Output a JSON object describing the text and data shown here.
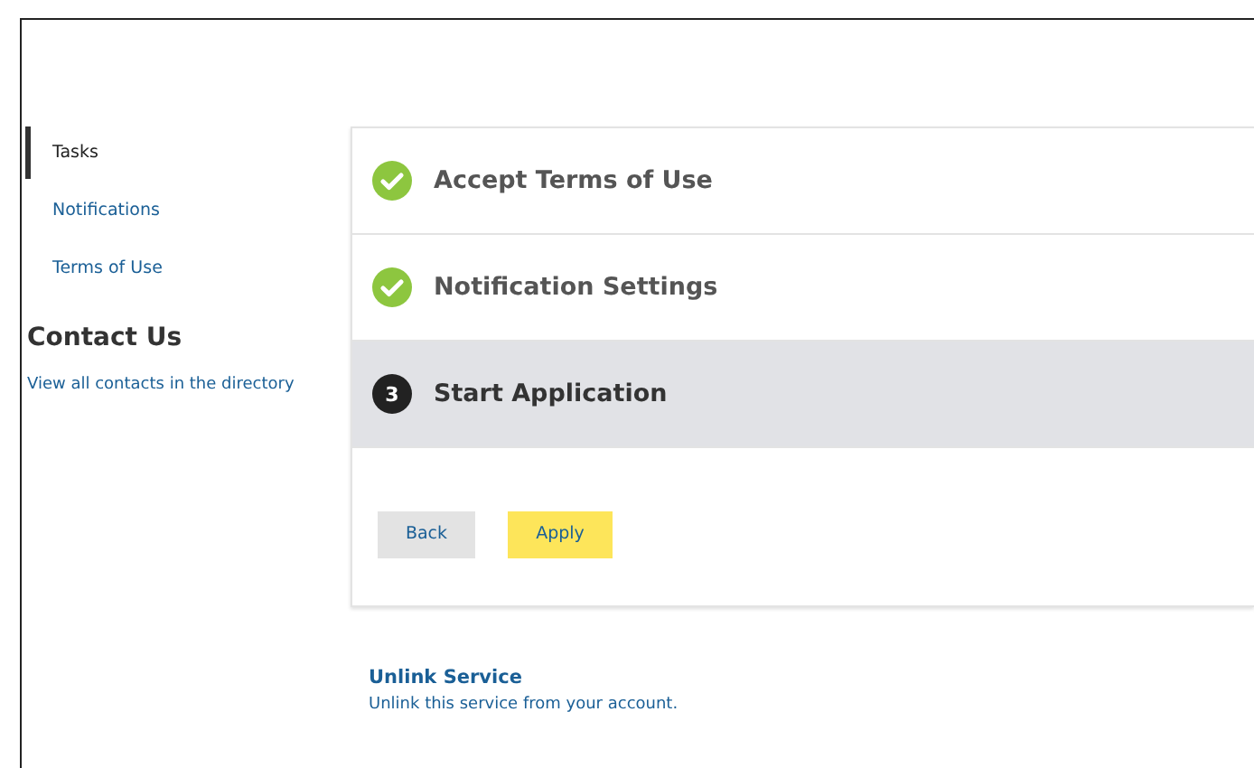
{
  "sidebar": {
    "items": [
      {
        "label": "Tasks",
        "selected": true
      },
      {
        "label": "Notifications",
        "selected": false
      },
      {
        "label": "Terms of Use",
        "selected": false
      }
    ],
    "contact": {
      "heading": "Contact Us",
      "link": "View all contacts in the directory"
    }
  },
  "steps": [
    {
      "title": "Accept Terms of Use",
      "kind": "done",
      "selected": false
    },
    {
      "title": "Notification Settings",
      "kind": "done",
      "selected": false
    },
    {
      "title": "Start Application",
      "kind": "current",
      "number": "3",
      "selected": true
    }
  ],
  "buttons": [
    {
      "label": "Back",
      "kind": "secondary"
    },
    {
      "label": "Apply",
      "kind": "primary"
    }
  ],
  "unlink": {
    "title": "Unlink Service",
    "description": "Unlink this service from your account."
  }
}
